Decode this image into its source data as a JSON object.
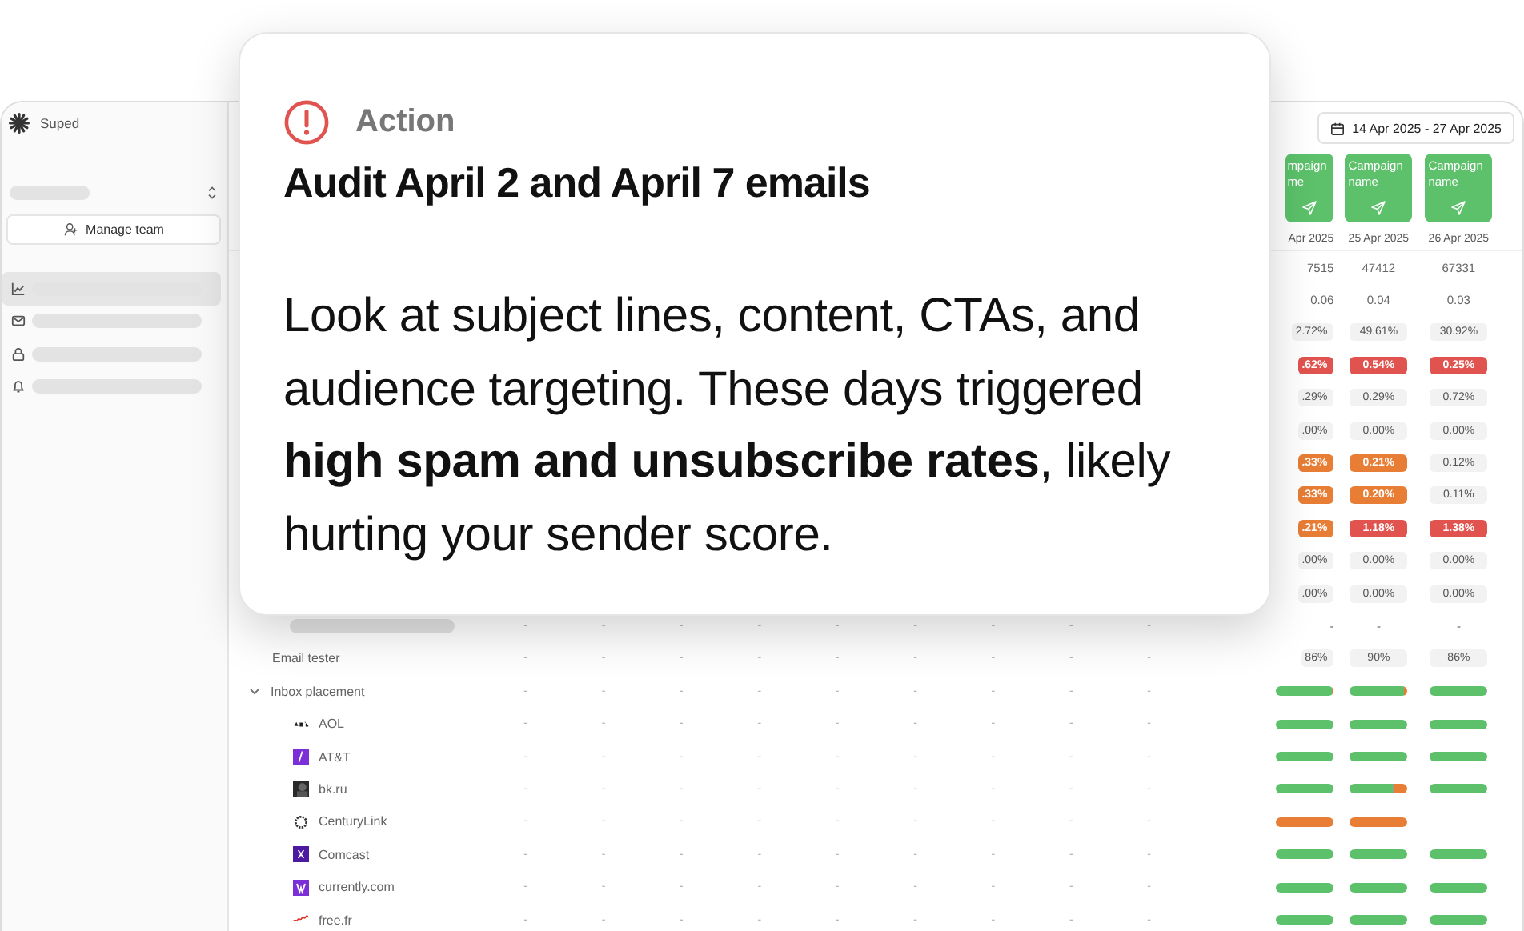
{
  "sidebar": {
    "brand": "Suped",
    "manage_button": "Manage team",
    "nav": [
      {
        "selected": true
      },
      {
        "selected": false
      },
      {
        "selected": false
      },
      {
        "selected": false
      }
    ]
  },
  "date_range": "14 Apr 2025 - 27 Apr 2025",
  "campaigns": [
    {
      "name": "mpaign me",
      "date": "Apr 2025"
    },
    {
      "name": "Campaign name",
      "date": "25 Apr 2025"
    },
    {
      "name": "Campaign name",
      "date": "26 Apr 2025"
    }
  ],
  "rows": [
    {
      "kind": "metric",
      "cells": [
        {
          "text": "7515",
          "kind": "text"
        },
        {
          "text": "47412",
          "kind": "text"
        },
        {
          "text": "67331",
          "kind": "text"
        }
      ]
    },
    {
      "kind": "metric",
      "cells": [
        {
          "text": "0.06",
          "kind": "text"
        },
        {
          "text": "0.04",
          "kind": "text"
        },
        {
          "text": "0.03",
          "kind": "text"
        }
      ]
    },
    {
      "kind": "metric",
      "cells": [
        {
          "text": "2.72%",
          "kind": "plain"
        },
        {
          "text": "49.61%",
          "kind": "plain"
        },
        {
          "text": "30.92%",
          "kind": "plain"
        }
      ]
    },
    {
      "kind": "metric",
      "cells": [
        {
          "text": ".62%",
          "kind": "red"
        },
        {
          "text": "0.54%",
          "kind": "red"
        },
        {
          "text": "0.25%",
          "kind": "red"
        }
      ]
    },
    {
      "kind": "metric",
      "cells": [
        {
          "text": ".29%",
          "kind": "plain"
        },
        {
          "text": "0.29%",
          "kind": "plain"
        },
        {
          "text": "0.72%",
          "kind": "plain"
        }
      ]
    },
    {
      "kind": "metric",
      "cells": [
        {
          "text": ".00%",
          "kind": "plain"
        },
        {
          "text": "0.00%",
          "kind": "plain"
        },
        {
          "text": "0.00%",
          "kind": "plain"
        }
      ]
    },
    {
      "kind": "metric",
      "cells": [
        {
          "text": ".33%",
          "kind": "orange"
        },
        {
          "text": "0.21%",
          "kind": "orange"
        },
        {
          "text": "0.12%",
          "kind": "plain"
        }
      ]
    },
    {
      "kind": "metric",
      "cells": [
        {
          "text": ".33%",
          "kind": "orange"
        },
        {
          "text": "0.20%",
          "kind": "orange"
        },
        {
          "text": "0.11%",
          "kind": "plain"
        }
      ]
    },
    {
      "kind": "metric",
      "cells": [
        {
          "text": ".21%",
          "kind": "orange"
        },
        {
          "text": "1.18%",
          "kind": "red"
        },
        {
          "text": "1.38%",
          "kind": "red"
        }
      ]
    },
    {
      "kind": "metric",
      "cells": [
        {
          "text": ".00%",
          "kind": "plain"
        },
        {
          "text": "0.00%",
          "kind": "plain"
        },
        {
          "text": "0.00%",
          "kind": "plain"
        }
      ]
    },
    {
      "kind": "metric",
      "cells": [
        {
          "text": ".00%",
          "kind": "plain"
        },
        {
          "text": "0.00%",
          "kind": "plain"
        },
        {
          "text": "0.00%",
          "kind": "plain"
        }
      ]
    },
    {
      "kind": "placeholder",
      "dashes": [
        "-",
        "-",
        "-",
        "-",
        "-",
        "-",
        "-",
        "-",
        "-"
      ],
      "cells": [
        {
          "text": "-",
          "kind": "text"
        },
        {
          "text": "-",
          "kind": "text"
        },
        {
          "text": "-",
          "kind": "text"
        }
      ]
    },
    {
      "kind": "text",
      "label": "Email tester",
      "dashes": [
        "-",
        "-",
        "-",
        "-",
        "-",
        "-",
        "-",
        "-",
        "-"
      ],
      "cells": [
        {
          "text": "86%",
          "kind": "plain"
        },
        {
          "text": "90%",
          "kind": "plain"
        },
        {
          "text": "86%",
          "kind": "plain"
        }
      ]
    },
    {
      "kind": "group",
      "label": "Inbox placement",
      "expanded": true,
      "dashes": [
        "-",
        "-",
        "-",
        "-",
        "-",
        "-",
        "-",
        "-",
        "-"
      ],
      "bars": [
        [
          {
            "color": "#5cc16a",
            "level": 0.97
          },
          {
            "color": "#e87d35",
            "level": 0.03
          }
        ],
        [
          {
            "color": "#5cc16a",
            "level": 0.95
          },
          {
            "color": "#e87d35",
            "level": 0.05
          }
        ],
        [
          {
            "color": "#5cc16a",
            "level": 0.98
          },
          {
            "color": "#9a9a9a",
            "level": 0.02
          }
        ]
      ]
    },
    {
      "kind": "provider",
      "label": "AOL",
      "dashes": [
        "-",
        "-",
        "-",
        "-",
        "-",
        "-",
        "-",
        "-",
        "-"
      ],
      "bars": [
        [
          {
            "color": "#5cc16a",
            "level": 1
          }
        ],
        [
          {
            "color": "#5cc16a",
            "level": 1
          }
        ],
        [
          {
            "color": "#5cc16a",
            "level": 1
          }
        ]
      ]
    },
    {
      "kind": "provider",
      "label": "AT&T",
      "dashes": [
        "-",
        "-",
        "-",
        "-",
        "-",
        "-",
        "-",
        "-",
        "-"
      ],
      "bars": [
        [
          {
            "color": "#5cc16a",
            "level": 1
          }
        ],
        [
          {
            "color": "#5cc16a",
            "level": 1
          }
        ],
        [
          {
            "color": "#5cc16a",
            "level": 1
          }
        ]
      ]
    },
    {
      "kind": "provider",
      "label": "bk.ru",
      "dashes": [
        "-",
        "-",
        "-",
        "-",
        "-",
        "-",
        "-",
        "-",
        "-"
      ],
      "bars": [
        [
          {
            "color": "#5cc16a",
            "level": 1
          }
        ],
        [
          {
            "color": "#5cc16a",
            "level": 0.74
          },
          {
            "color": "#9a9a9a",
            "level": 0.02
          },
          {
            "color": "#e87d35",
            "level": 0.24
          }
        ],
        [
          {
            "color": "#5cc16a",
            "level": 1
          }
        ]
      ]
    },
    {
      "kind": "provider",
      "label": "CenturyLink",
      "dashes": [
        "-",
        "-",
        "-",
        "-",
        "-",
        "-",
        "-",
        "-",
        "-"
      ],
      "bars": [
        [
          {
            "color": "#e87d35",
            "level": 1
          }
        ],
        [
          {
            "color": "#e87d35",
            "level": 1
          }
        ]
      ]
    },
    {
      "kind": "provider",
      "label": "Comcast",
      "dashes": [
        "-",
        "-",
        "-",
        "-",
        "-",
        "-",
        "-",
        "-",
        "-"
      ],
      "bars": [
        [
          {
            "color": "#5cc16a",
            "level": 1
          }
        ],
        [
          {
            "color": "#5cc16a",
            "level": 1
          }
        ],
        [
          {
            "color": "#5cc16a",
            "level": 1
          }
        ]
      ]
    },
    {
      "kind": "provider",
      "label": "currently.com",
      "dashes": [
        "-",
        "-",
        "-",
        "-",
        "-",
        "-",
        "-",
        "-",
        "-"
      ],
      "bars": [
        [
          {
            "color": "#5cc16a",
            "level": 1
          }
        ],
        [
          {
            "color": "#5cc16a",
            "level": 1
          }
        ],
        [
          {
            "color": "#5cc16a",
            "level": 1
          }
        ]
      ]
    },
    {
      "kind": "provider",
      "label": "free.fr",
      "dashes": [
        "-",
        "-",
        "-",
        "-",
        "-",
        "-",
        "-",
        "-",
        "-"
      ],
      "bars": [
        [
          {
            "color": "#5cc16a",
            "level": 1
          }
        ],
        [
          {
            "color": "#5cc16a",
            "level": 1
          }
        ],
        [
          {
            "color": "#5cc16a",
            "level": 1
          }
        ]
      ]
    }
  ],
  "card": {
    "label": "Action",
    "title": "Audit April 2 and April 7 emails",
    "body": "Look at subject lines, content, CTAs, and audience targeting. These days triggered **high spam and unsubscribe rates**, likely hurting your sender score."
  }
}
